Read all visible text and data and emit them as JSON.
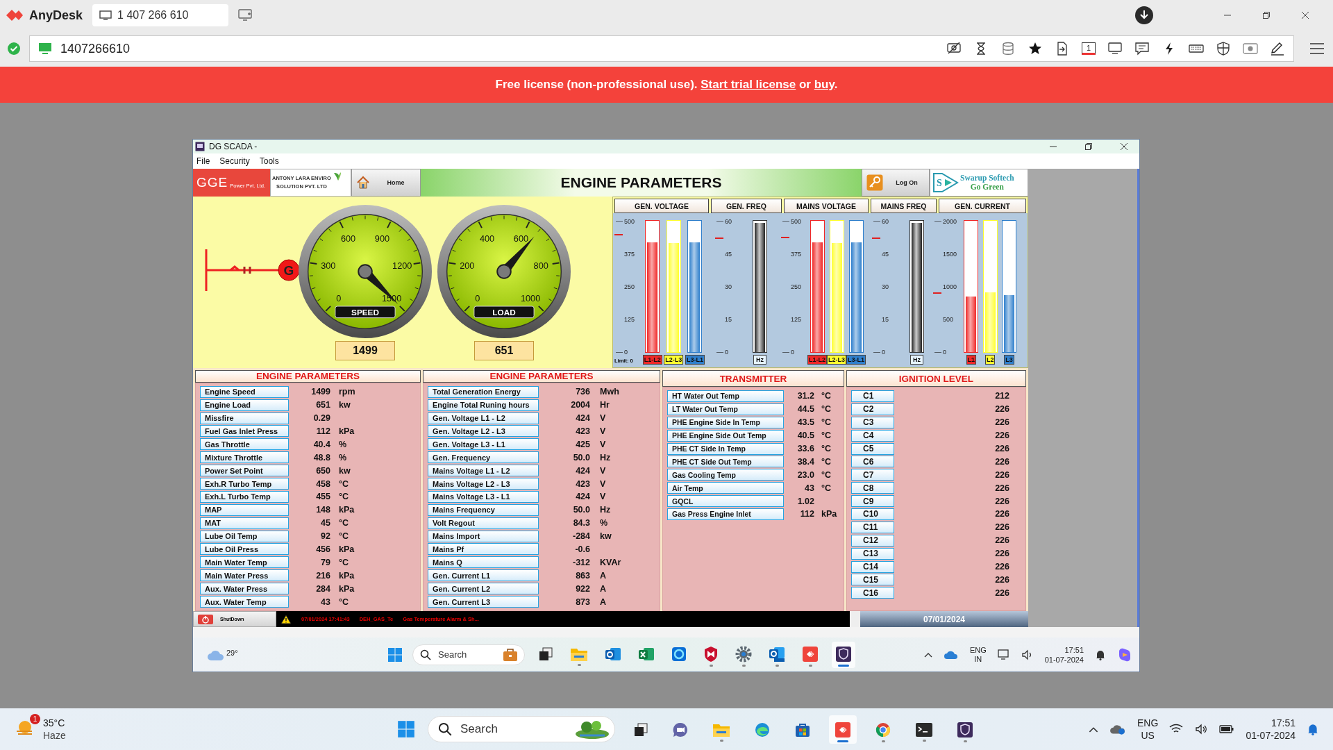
{
  "anydesk": {
    "app_name": "AnyDesk",
    "tab_label": "1 407 266 610",
    "address": "1407266610",
    "display_number": "1"
  },
  "banner": {
    "before": "Free license (non-professional use).",
    "link1": "Start trial license",
    "middle": "or",
    "link2": "buy",
    "after": "."
  },
  "window": {
    "title": "DG SCADA -"
  },
  "menu": [
    "File",
    "Security",
    "Tools"
  ],
  "header": {
    "logo": "GGE",
    "logo_sub": "Power Pvt. Ltd.",
    "partner_line1": "ANTONY LARA ENVIRO",
    "partner_line2": "SOLUTION PVT. LTD",
    "home": "Home",
    "title": "ENGINE PARAMETERS",
    "logon": "Log On",
    "brand_mark": "S",
    "brand_line1": "Swarup Softech",
    "brand_line2": "Go Green"
  },
  "generator_symbol": "G",
  "gauges": [
    {
      "label": "SPEED",
      "ticks": [
        "0",
        "300",
        "600",
        "900",
        "1200",
        "1500"
      ],
      "reading": "1499"
    },
    {
      "label": "LOAD",
      "ticks": [
        "0",
        "200",
        "400",
        "600",
        "800",
        "1000"
      ],
      "reading": "651"
    }
  ],
  "meters_note": "Limit: 0",
  "meters": [
    {
      "title": "GEN. VOLTAGE",
      "scale": [
        "500",
        "375",
        "250",
        "125",
        "0"
      ],
      "limit": {
        "level": 0.9
      },
      "bars": [
        {
          "kind": "phase",
          "label": "L1-L2",
          "color": "#f02828",
          "level": 0.848
        },
        {
          "kind": "phase",
          "label": "L2-L3",
          "color": "#ffff30",
          "level": 0.846
        },
        {
          "kind": "phase",
          "label": "L3-L1",
          "color": "#2f7fcc",
          "level": 0.85
        }
      ]
    },
    {
      "title": "GEN. FREQ",
      "scale": [
        "60",
        "45",
        "30",
        "15",
        "0"
      ],
      "limit": {
        "level": 0.87
      },
      "bars": [
        {
          "kind": "frequency",
          "label": "Hz",
          "color": "#555555",
          "level": 1
        }
      ]
    },
    {
      "title": "MAINS VOLTAGE",
      "scale": [
        "500",
        "375",
        "250",
        "125",
        "0"
      ],
      "limit": {
        "level": 0.88
      },
      "bars": [
        {
          "kind": "phase",
          "label": "L1-L2",
          "color": "#f02828",
          "level": 0.848
        },
        {
          "kind": "phase",
          "label": "L2-L3",
          "color": "#ffff30",
          "level": 0.846
        },
        {
          "kind": "phase",
          "label": "L3-L1",
          "color": "#2f7fcc",
          "level": 0.848
        }
      ]
    },
    {
      "title": "MAINS FREQ",
      "scale": [
        "60",
        "45",
        "30",
        "15",
        "0"
      ],
      "limit": {
        "level": 0.87
      },
      "bars": [
        {
          "kind": "frequency",
          "label": "Hz",
          "color": "#555555",
          "level": 1
        }
      ]
    },
    {
      "title": "GEN. CURRENT",
      "scale": [
        "2000",
        "1500",
        "1000",
        "500",
        "0"
      ],
      "limit": {
        "level": 0.45
      },
      "bars": [
        {
          "kind": "phase",
          "label": "L1",
          "color": "#f02828",
          "level": 0.43
        },
        {
          "kind": "phase",
          "label": "L2",
          "color": "#ffff30",
          "level": 0.46
        },
        {
          "kind": "phase",
          "label": "L3",
          "color": "#2f7fcc",
          "level": 0.44
        }
      ]
    }
  ],
  "engine_table": {
    "title": "ENGINE PARAMETERS",
    "rows": [
      {
        "label": "Engine Speed",
        "value": "1499",
        "unit": "rpm"
      },
      {
        "label": "Engine Load",
        "value": "651",
        "unit": "kw"
      },
      {
        "label": "Missfire",
        "value": "0.29"
      },
      {
        "label": "Fuel Gas Inlet Press",
        "value": "112",
        "unit": "kPa"
      },
      {
        "label": "Gas Throttle",
        "value": "40.4",
        "unit": "%"
      },
      {
        "label": "Mixture Throttle",
        "value": "48.8",
        "unit": "%"
      },
      {
        "label": "Power Set Point",
        "value": "650",
        "unit": "kw"
      },
      {
        "label": "Exh.R Turbo Temp",
        "value": "458",
        "unit": "°C"
      },
      {
        "label": "Exh.L Turbo Temp",
        "value": "455",
        "unit": "°C"
      },
      {
        "label": "MAP",
        "value": "148",
        "unit": "kPa"
      },
      {
        "label": "MAT",
        "value": "45",
        "unit": "°C"
      },
      {
        "label": "Lube Oil Temp",
        "value": "92",
        "unit": "°C"
      },
      {
        "label": "Lube Oil Press",
        "value": "456",
        "unit": "kPa"
      },
      {
        "label": "Main Water Temp",
        "value": "79",
        "unit": "°C"
      },
      {
        "label": "Main Water Press",
        "value": "216",
        "unit": "kPa"
      },
      {
        "label": "Aux. Water Press",
        "value": "284",
        "unit": "kPa"
      },
      {
        "label": "Aux. Water Temp",
        "value": "43",
        "unit": "°C"
      }
    ]
  },
  "electrical_table": {
    "title": "ENGINE PARAMETERS",
    "rows": [
      {
        "label": "Total Generation Energy",
        "value": "736",
        "unit": "Mwh"
      },
      {
        "label": "Engine Total Runing hours",
        "value": "2004",
        "unit": "Hr"
      },
      {
        "label": "Gen. Voltage L1 - L2",
        "value": "424",
        "unit": "V"
      },
      {
        "label": "Gen. Voltage L2 - L3",
        "value": "423",
        "unit": "V"
      },
      {
        "label": "Gen. Voltage L3 - L1",
        "value": "425",
        "unit": "V"
      },
      {
        "label": "Gen. Frequency",
        "value": "50.0",
        "unit": "Hz"
      },
      {
        "label": "Mains Voltage L1 - L2",
        "value": "424",
        "unit": "V"
      },
      {
        "label": "Mains Voltage L2 - L3",
        "value": "423",
        "unit": "V"
      },
      {
        "label": "Mains Voltage L3 - L1",
        "value": "424",
        "unit": "V"
      },
      {
        "label": "Mains Frequency",
        "value": "50.0",
        "unit": "Hz"
      },
      {
        "label": "Volt Regout",
        "value": "84.3",
        "unit": "%"
      },
      {
        "label": "Mains Import",
        "value": "-284",
        "unit": "kw"
      },
      {
        "label": "Mains Pf",
        "value": "-0.6"
      },
      {
        "label": "Mains Q",
        "value": "-312",
        "unit": "KVAr"
      },
      {
        "label": "Gen. Current L1",
        "value": "863",
        "unit": "A"
      },
      {
        "label": "Gen. Current L2",
        "value": "922",
        "unit": "A"
      },
      {
        "label": "Gen. Current L3",
        "value": "873",
        "unit": "A"
      }
    ]
  },
  "transmitter_table": {
    "title": "TRANSMITTER",
    "rows": [
      {
        "label": "HT  Water Out Temp",
        "value": "31.2",
        "unit": "°C"
      },
      {
        "label": "LT Water Out Temp",
        "value": "44.5",
        "unit": "°C"
      },
      {
        "label": "PHE Engine Side In Temp",
        "value": "43.5",
        "unit": "°C"
      },
      {
        "label": "PHE Engine Side Out Temp",
        "value": "40.5",
        "unit": "°C"
      },
      {
        "label": "PHE CT Side In Temp",
        "value": "33.6",
        "unit": "°C"
      },
      {
        "label": "PHE CT Side Out Temp",
        "value": "38.4",
        "unit": "°C"
      },
      {
        "label": "Gas Cooling Temp",
        "value": "23.0",
        "unit": "°C"
      },
      {
        "label": "Air Temp",
        "value": "43",
        "unit": "°C"
      },
      {
        "label": "GQCL",
        "value": "1.02"
      },
      {
        "label": "Gas Press Engine Inlet",
        "value": "112",
        "unit": "kPa"
      }
    ]
  },
  "ignition_table": {
    "title": "IGNITION LEVEL",
    "rows": [
      {
        "label": "C1",
        "value": "212"
      },
      {
        "label": "C2",
        "value": "226"
      },
      {
        "label": "C3",
        "value": "226"
      },
      {
        "label": "C4",
        "value": "226"
      },
      {
        "label": "C5",
        "value": "226"
      },
      {
        "label": "C6",
        "value": "226"
      },
      {
        "label": "C7",
        "value": "226"
      },
      {
        "label": "C8",
        "value": "226"
      },
      {
        "label": "C9",
        "value": "226"
      },
      {
        "label": "C10",
        "value": "226"
      },
      {
        "label": "C11",
        "value": "226"
      },
      {
        "label": "C12",
        "value": "226"
      },
      {
        "label": "C13",
        "value": "226"
      },
      {
        "label": "C14",
        "value": "226"
      },
      {
        "label": "C15",
        "value": "226"
      },
      {
        "label": "C16",
        "value": "226"
      }
    ]
  },
  "status": {
    "shutdown": "ShutDown",
    "alarm_time": "07/01/2024 17:41:43",
    "alarm_tag": "DEH_GAS_Te",
    "alarm_text": "Gas Temperature Alarm & Sh...",
    "date": "07/01/2024"
  },
  "remote_taskbar": {
    "temperature": "29°",
    "search": "Search",
    "lang1": "ENG",
    "lang2": "IN",
    "time": "17:51",
    "date": "01-07-2024",
    "apps": [
      {
        "kind": "task-view",
        "running": false,
        "selected": false
      },
      {
        "kind": "folder",
        "running": true,
        "selected": false
      },
      {
        "kind": "mail",
        "running": false,
        "selected": false
      },
      {
        "kind": "spreadsheet",
        "running": false,
        "selected": false
      },
      {
        "kind": "ring",
        "running": false,
        "selected": false
      },
      {
        "kind": "shield",
        "running": true,
        "selected": false
      },
      {
        "kind": "gear",
        "running": true,
        "selected": false
      },
      {
        "kind": "mail-new",
        "running": true,
        "selected": false
      },
      {
        "kind": "remote",
        "running": true,
        "selected": false
      },
      {
        "kind": "scada",
        "running": true,
        "selected": true
      }
    ]
  },
  "host_taskbar": {
    "temperature": "35°C",
    "weather": "Haze",
    "badge": "1",
    "search": "Search",
    "lang1": "ENG",
    "lang2": "US",
    "time": "17:51",
    "date": "01-07-2024",
    "apps": [
      {
        "kind": "task-view",
        "running": false,
        "selected": false
      },
      {
        "kind": "chat",
        "running": false,
        "selected": false
      },
      {
        "kind": "folder",
        "running": true,
        "selected": false
      },
      {
        "kind": "browser",
        "running": false,
        "selected": false
      },
      {
        "kind": "store",
        "running": false,
        "selected": false
      },
      {
        "kind": "remote",
        "running": true,
        "selected": true
      },
      {
        "kind": "chrome",
        "running": true,
        "selected": false
      },
      {
        "kind": "terminal",
        "running": true,
        "selected": false
      },
      {
        "kind": "scada",
        "running": true,
        "selected": false
      }
    ]
  }
}
